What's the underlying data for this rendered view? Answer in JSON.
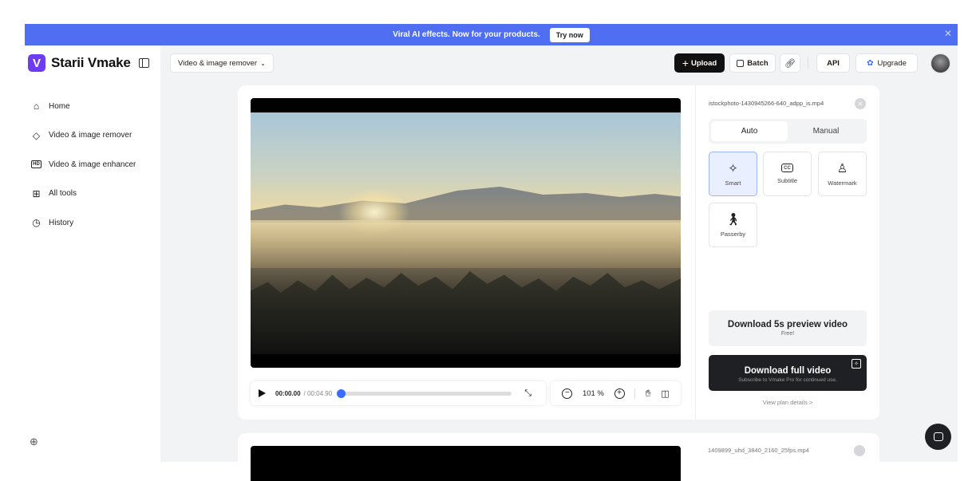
{
  "banner": {
    "text": "Viral AI effects. Now for your products.",
    "cta": "Try now",
    "close": "✕"
  },
  "brand": {
    "logo_letter": "V",
    "name": "Starii Vmake",
    "accent": "#6d3cf0"
  },
  "nav": {
    "items": [
      {
        "label": "Home",
        "icon": "home-icon"
      },
      {
        "label": "Video & image remover",
        "icon": "eraser-icon"
      },
      {
        "label": "Video & image enhancer",
        "icon": "hd-icon"
      },
      {
        "label": "All tools",
        "icon": "grid-icon"
      },
      {
        "label": "History",
        "icon": "clock-icon"
      }
    ]
  },
  "header": {
    "tool_select": "Video & image remover",
    "upload": "Upload",
    "batch": "Batch",
    "api": "API",
    "upgrade": "Upgrade"
  },
  "player": {
    "current_time": "00:00.00",
    "total_time": "/ 00:04.90",
    "progress": 0.0,
    "zoom_level": "101 %"
  },
  "panel": {
    "file_name": "istockphoto-1430945266-640_adpp_is.mp4",
    "tabs": [
      {
        "label": "Auto",
        "active": true
      },
      {
        "label": "Manual",
        "active": false
      }
    ],
    "tools": [
      {
        "label": "Smart",
        "icon": "magic-wand-icon",
        "selected": true
      },
      {
        "label": "Subtitle",
        "icon": "subtitle-icon",
        "icon_text": "CC",
        "selected": false
      },
      {
        "label": "Watermark",
        "icon": "watermark-icon",
        "selected": false
      },
      {
        "label": "Passerby",
        "icon": "walking-person-icon",
        "selected": false
      }
    ],
    "download_preview": {
      "title": "Download 5s preview video",
      "subtitle": "Free!"
    },
    "download_full": {
      "title": "Download full video",
      "subtitle": "Subscribe to Vmake Pro for continued use."
    },
    "plan_link": "View plan details >"
  },
  "second_item": {
    "file_name": "1409899_uhd_3840_2160_25fps.mp4"
  },
  "colors": {
    "banner": "#4f6ef2",
    "accent_blue": "#3b6cff",
    "dark": "#1f2023"
  }
}
